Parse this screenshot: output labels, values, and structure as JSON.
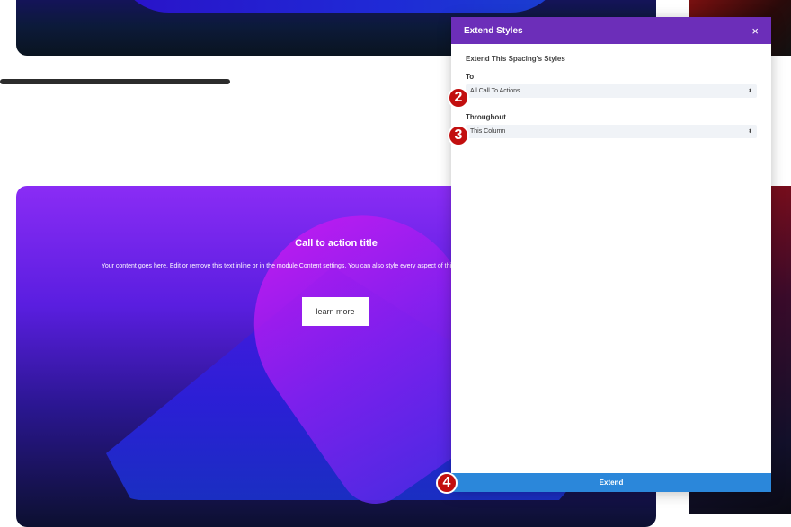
{
  "page": {
    "cta_title": "Call to action title",
    "cta_body": "Your content goes here. Edit or remove this text inline or in the module Content settings. You can also style every aspect of this content in the module Advanced settings.",
    "cta_button": "learn more"
  },
  "modal": {
    "title": "Extend Styles",
    "close_icon": "×",
    "section_title": "Extend This Spacing's Styles",
    "to_label": "To",
    "to_value": "All Call To Actions",
    "throughout_label": "Throughout",
    "throughout_value": "This Column",
    "select_arrows": "⬍",
    "extend_label": "Extend"
  },
  "steps": {
    "step2": "2",
    "step3": "3",
    "step4": "4"
  },
  "colors": {
    "modal_header": "#6c2eb9",
    "extend_button": "#2b87da",
    "badge": "#c20f0f"
  }
}
